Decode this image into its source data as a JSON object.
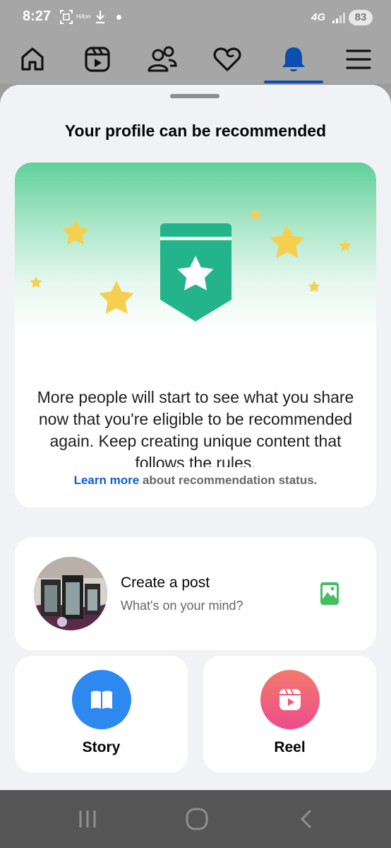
{
  "status_bar": {
    "time": "8:27",
    "carrier_text": "Hilton",
    "network": "4G",
    "battery": "83"
  },
  "nav_tabs": [
    {
      "name": "home-tab",
      "icon": "home-icon",
      "active": false
    },
    {
      "name": "video-tab",
      "icon": "video-icon",
      "active": false
    },
    {
      "name": "friends-tab",
      "icon": "friends-icon",
      "active": false
    },
    {
      "name": "dating-tab",
      "icon": "heart-icon",
      "active": false
    },
    {
      "name": "notifications-tab",
      "icon": "bell-icon",
      "active": true
    },
    {
      "name": "menu-tab",
      "icon": "menu-icon",
      "active": false
    }
  ],
  "sheet": {
    "title": "Your profile can be recommended",
    "body": "More people will start to see what you share now that you're eligible to be recommended again. Keep creating unique content that follows the rules.",
    "learn_more": "Learn more",
    "learn_more_suffix": " about recommendation status."
  },
  "composer": {
    "title": "Create a post",
    "placeholder": "What's on your mind?"
  },
  "tiles": {
    "story": "Story",
    "reel": "Reel"
  },
  "colors": {
    "accent": "#1b5fcf",
    "active_tab": "#0b4fb0",
    "badge_green": "#1fae7e",
    "star": "#f7cf4f",
    "story_blue": "#2d88f0",
    "reel_pink": "#f2577a"
  }
}
